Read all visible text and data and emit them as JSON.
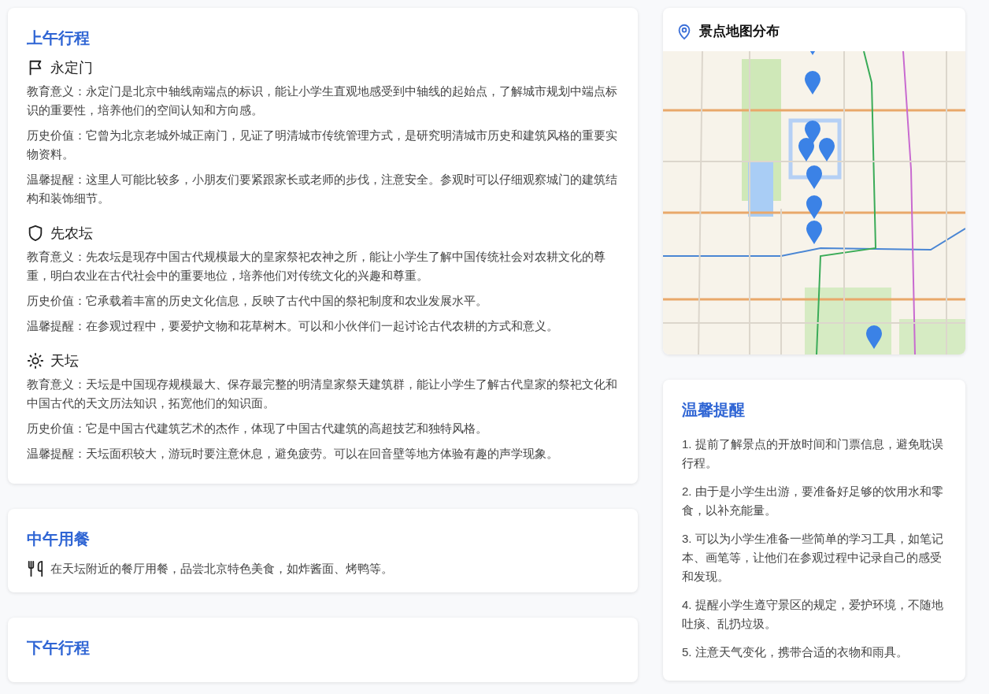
{
  "morning": {
    "title": "上午行程",
    "spots": [
      {
        "kind": "flag",
        "name": "永定门",
        "lines": [
          "教育意义：永定门是北京中轴线南端点的标识，能让小学生直观地感受到中轴线的起始点，了解城市规划中端点标识的重要性，培养他们的空间认知和方向感。",
          "历史价值：它曾为北京老城外城正南门，见证了明清城市传统管理方式，是研究明清城市历史和建筑风格的重要实物资料。",
          "温馨提醒：这里人可能比较多，小朋友们要紧跟家长或老师的步伐，注意安全。参观时可以仔细观察城门的建筑结构和装饰细节。"
        ]
      },
      {
        "kind": "shield",
        "name": "先农坛",
        "lines": [
          "教育意义：先农坛是现存中国古代规模最大的皇家祭祀农神之所，能让小学生了解中国传统社会对农耕文化的尊重，明白农业在古代社会中的重要地位，培养他们对传统文化的兴趣和尊重。",
          "历史价值：它承载着丰富的历史文化信息，反映了古代中国的祭祀制度和农业发展水平。",
          "温馨提醒：在参观过程中，要爱护文物和花草树木。可以和小伙伴们一起讨论古代农耕的方式和意义。"
        ]
      },
      {
        "kind": "sun",
        "name": "天坛",
        "lines": [
          "教育意义：天坛是中国现存规模最大、保存最完整的明清皇家祭天建筑群，能让小学生了解古代皇家的祭祀文化和中国古代的天文历法知识，拓宽他们的知识面。",
          "历史价值：它是中国古代建筑艺术的杰作，体现了中国古代建筑的高超技艺和独特风格。",
          "温馨提醒：天坛面积较大，游玩时要注意休息，避免疲劳。可以在回音壁等地方体验有趣的声学现象。"
        ]
      }
    ]
  },
  "lunch": {
    "title": "中午用餐",
    "text": "在天坛附近的餐厅用餐，品尝北京特色美食，如炸酱面、烤鸭等。"
  },
  "afternoon": {
    "title": "下午行程"
  },
  "map": {
    "title": "景点地图分布"
  },
  "tips": {
    "title": "温馨提醒",
    "items": [
      "1. 提前了解景点的开放时间和门票信息，避免耽误行程。",
      "2. 由于是小学生出游，要准备好足够的饮用水和零食，以补充能量。",
      "3. 可以为小学生准备一些简单的学习工具，如笔记本、画笔等，让他们在参观过程中记录自己的感受和发现。",
      "4. 提醒小学生遵守景区的规定，爱护环境，不随地吐痰、乱扔垃圾。",
      "5. 注意天气变化，携带合适的衣物和雨具。"
    ]
  }
}
